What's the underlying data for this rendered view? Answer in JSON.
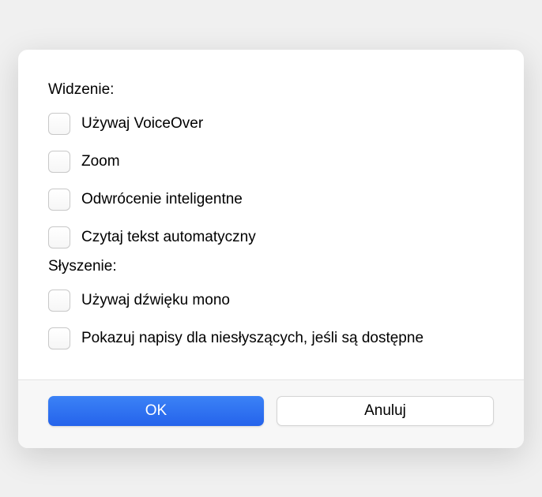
{
  "sections": {
    "vision": {
      "header": "Widzenie:",
      "items": [
        {
          "label": "Używaj VoiceOver",
          "checked": false
        },
        {
          "label": "Zoom",
          "checked": false
        },
        {
          "label": "Odwrócenie inteligentne",
          "checked": false
        },
        {
          "label": "Czytaj tekst automatyczny",
          "checked": false
        }
      ]
    },
    "hearing": {
      "header": "Słyszenie:",
      "items": [
        {
          "label": "Używaj dźwięku mono",
          "checked": false
        },
        {
          "label": "Pokazuj napisy dla niesłyszących, jeśli są dostępne",
          "checked": false
        }
      ]
    }
  },
  "buttons": {
    "ok": "OK",
    "cancel": "Anuluj"
  }
}
